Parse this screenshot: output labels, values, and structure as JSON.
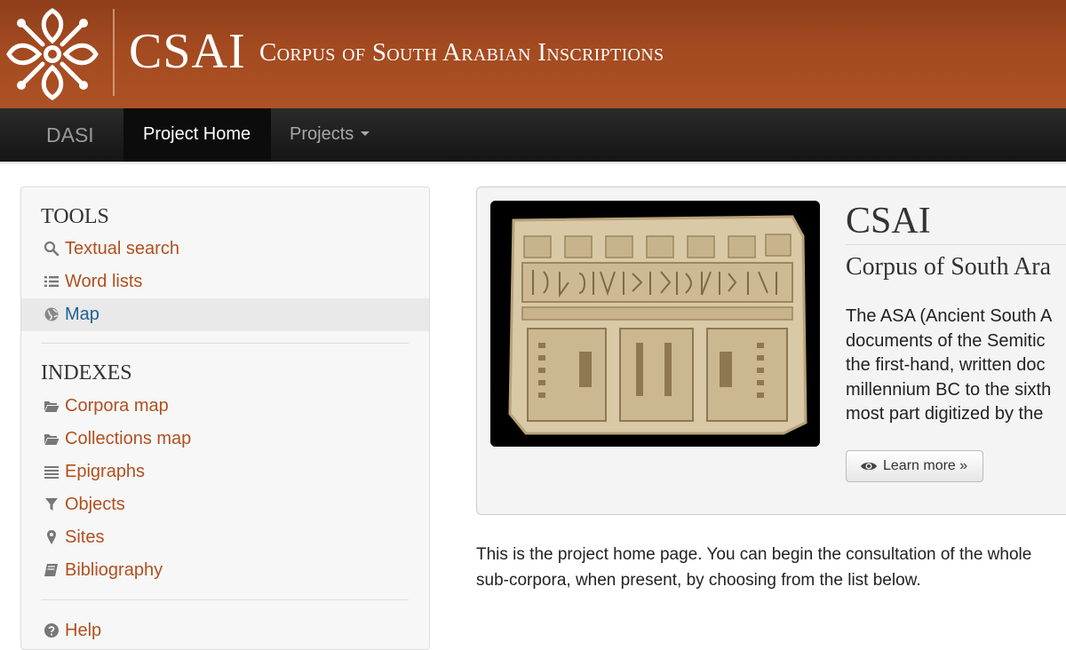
{
  "header": {
    "short_title": "CSAI",
    "long_title": "Corpus of South Arabian Inscriptions"
  },
  "navbar": {
    "brand": "DASI",
    "active_item": "Project Home",
    "projects_label": "Projects"
  },
  "sidebar": {
    "tools_heading": "TOOLS",
    "tools": [
      {
        "label": "Textual search",
        "icon": "search-icon"
      },
      {
        "label": "Word lists",
        "icon": "list-icon"
      },
      {
        "label": "Map",
        "icon": "globe-icon",
        "active": true
      }
    ],
    "indexes_heading": "INDEXES",
    "indexes": [
      {
        "label": "Corpora map",
        "icon": "folder-open-icon"
      },
      {
        "label": "Collections map",
        "icon": "folder-open-icon"
      },
      {
        "label": "Epigraphs",
        "icon": "align-justify-icon"
      },
      {
        "label": "Objects",
        "icon": "filter-icon"
      },
      {
        "label": "Sites",
        "icon": "map-marker-icon"
      },
      {
        "label": "Bibliography",
        "icon": "book-icon"
      }
    ],
    "help_label": "Help"
  },
  "hero": {
    "title": "CSAI",
    "subtitle": "Corpus of South Ara",
    "text_lines": [
      "The ASA (Ancient South A",
      "documents of the Semitic",
      "the first-hand, written doc",
      "millennium BC to the sixth",
      "most part digitized by the"
    ],
    "learn_more": "Learn more »"
  },
  "intro": {
    "line1": "This is the project home page. You can begin the consultation of the whole",
    "line2": "sub-corpora, when present, by choosing from the list below."
  },
  "colors": {
    "banner": "#a44a20",
    "link": "#b0501f",
    "active_link": "#1f6096",
    "navbar": "#1c1c1c"
  }
}
